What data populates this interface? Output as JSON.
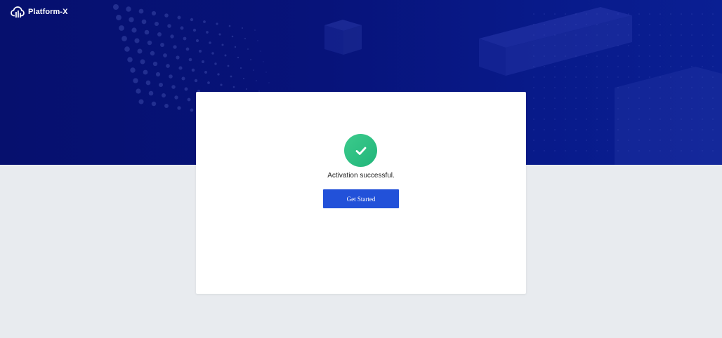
{
  "brand": {
    "name": "Platform-X",
    "icon": "cloud-logo-icon"
  },
  "activation": {
    "status_icon": "checkmark-icon",
    "message": "Activation successful.",
    "button_label": "Get Started"
  },
  "colors": {
    "hero_background": "#07137a",
    "page_background": "#e8ebef",
    "success_green": "#2bbf80",
    "button_blue": "#2251d9"
  }
}
